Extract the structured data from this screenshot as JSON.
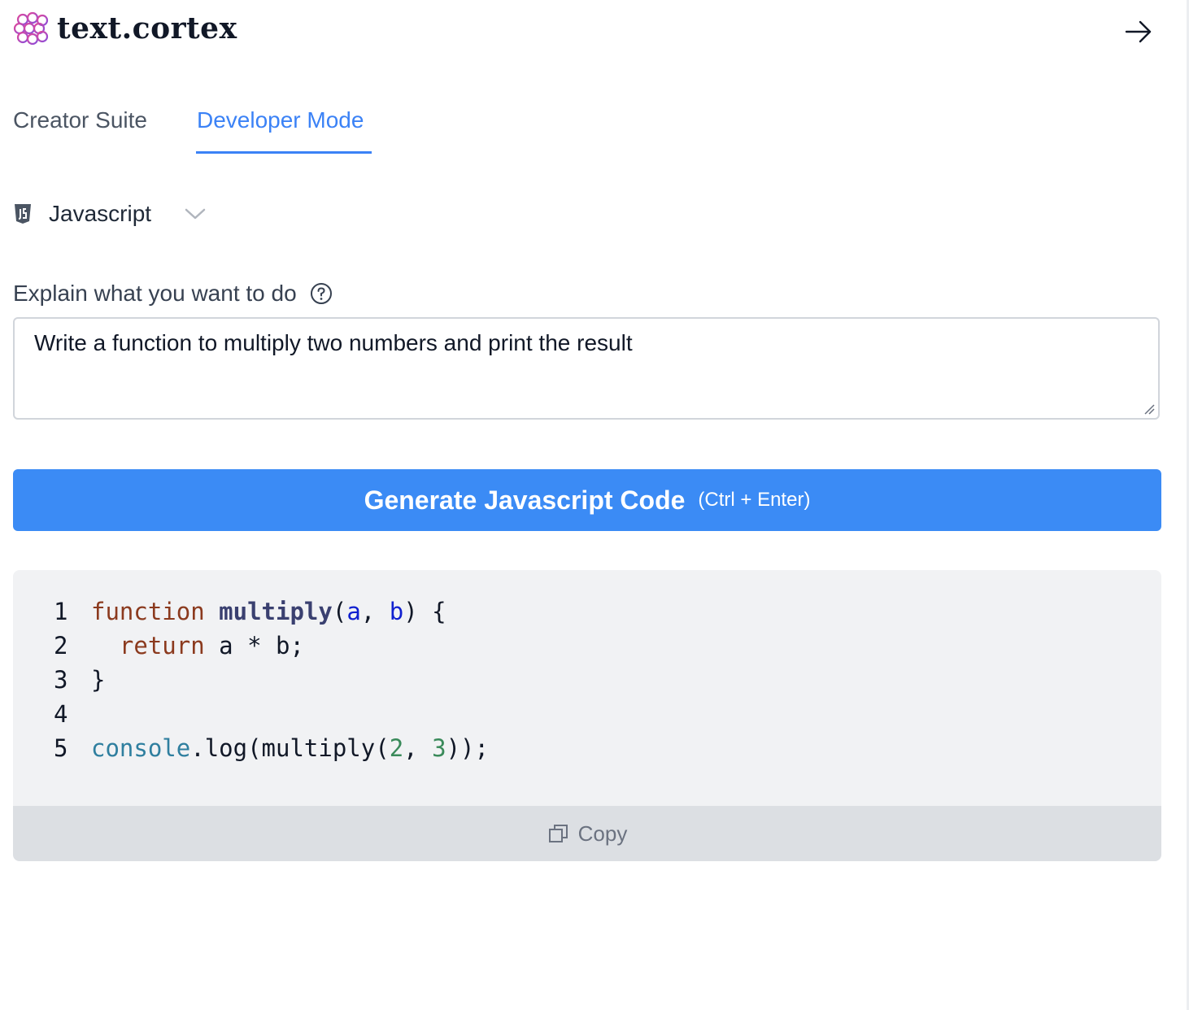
{
  "brand": {
    "name": "text.cortex"
  },
  "tabs": [
    {
      "label": "Creator Suite",
      "active": false
    },
    {
      "label": "Developer Mode",
      "active": true
    }
  ],
  "language_select": {
    "selected": "Javascript"
  },
  "prompt": {
    "label": "Explain what you want to do",
    "value": "Write a function to multiply two numbers and print the result"
  },
  "generate_button": {
    "label": "Generate Javascript Code",
    "hint": "(Ctrl + Enter)"
  },
  "code": {
    "line_numbers": [
      "1",
      "2",
      "3",
      "4",
      "5"
    ],
    "lines": [
      "function multiply(a, b) {",
      "  return a * b;",
      "}",
      "",
      "console.log(multiply(2, 3));"
    ]
  },
  "copy_button": {
    "label": "Copy"
  },
  "colors": {
    "accent": "#3b82f6",
    "button": "#3b8bf5",
    "code_bg": "#f1f2f4",
    "copy_bar": "#dcdfe3"
  }
}
